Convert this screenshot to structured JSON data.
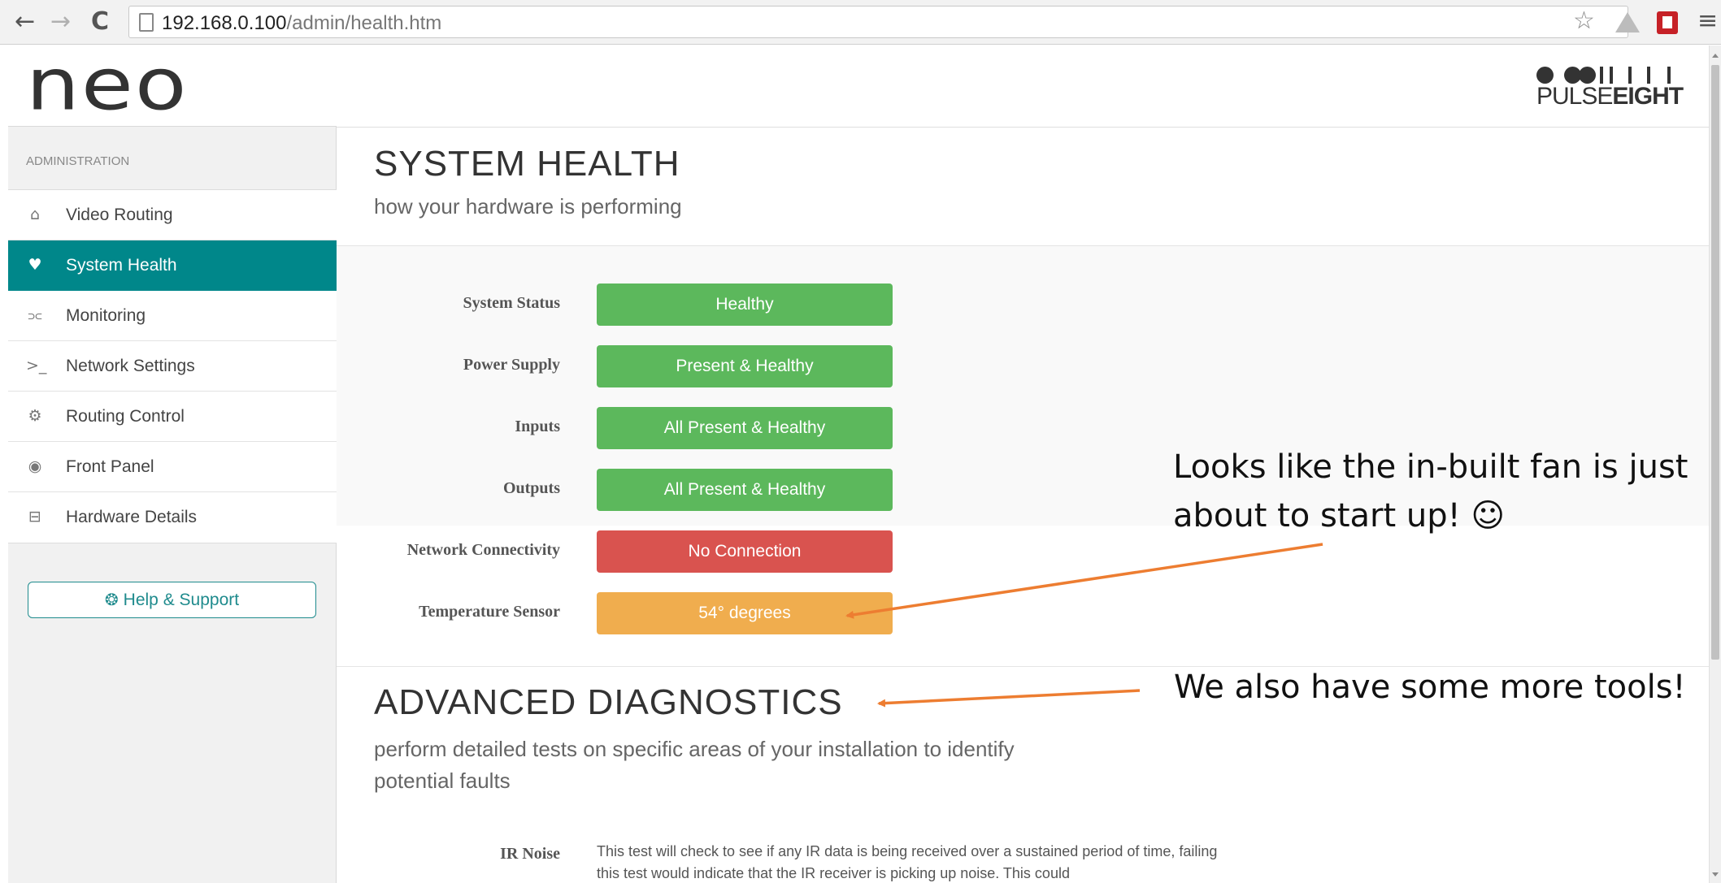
{
  "browser": {
    "url_host": "192.168.0.100",
    "url_path": "/admin/health.htm",
    "back_icon": "←",
    "forward_icon": "→",
    "reload_icon": "C",
    "star_icon": "☆",
    "menu_icon": "≡"
  },
  "app": {
    "logo": "neo",
    "brand_light": "PULSE",
    "brand_bold": "EIGHT"
  },
  "sidebar": {
    "section_label": "ADMINISTRATION",
    "items": [
      {
        "label": "Video Routing",
        "icon": "⌂"
      },
      {
        "label": "System Health",
        "icon": "♥"
      },
      {
        "label": "Monitoring",
        "icon": "⫗"
      },
      {
        "label": "Network Settings",
        "icon": ">_"
      },
      {
        "label": "Routing Control",
        "icon": "⚙"
      },
      {
        "label": "Front Panel",
        "icon": "◉"
      },
      {
        "label": "Hardware Details",
        "icon": "⊟"
      }
    ],
    "help_label": "Help & Support",
    "help_icon": "❂"
  },
  "main": {
    "title": "SYSTEM HEALTH",
    "subtitle": "how your hardware is performing",
    "statuses": [
      {
        "label": "System Status",
        "value": "Healthy",
        "color": "#5cb85c"
      },
      {
        "label": "Power Supply",
        "value": "Present & Healthy",
        "color": "#5cb85c"
      },
      {
        "label": "Inputs",
        "value": "All Present & Healthy",
        "color": "#5cb85c"
      },
      {
        "label": "Outputs",
        "value": "All Present & Healthy",
        "color": "#5cb85c"
      },
      {
        "label": "Network Connectivity",
        "value": "No Connection",
        "color": "#d9534f"
      },
      {
        "label": "Temperature Sensor",
        "value": "54° degrees",
        "color": "#f0ad4e"
      }
    ],
    "advanced_title": "ADVANCED DIAGNOSTICS",
    "advanced_subtitle": "perform detailed tests on specific areas of your installation to identify potential faults",
    "ir_label": "IR Noise",
    "ir_description": "This test will check to see if any IR data is being received over a sustained period of time, failing this test would indicate that the IR receiver is picking up noise. This could"
  },
  "annotations": {
    "fan_line1": "Looks like the in-built fan is just",
    "fan_line2": "about to start up! ☺",
    "tools": "We also have some more tools!",
    "arrow_color": "#ed7d31"
  }
}
